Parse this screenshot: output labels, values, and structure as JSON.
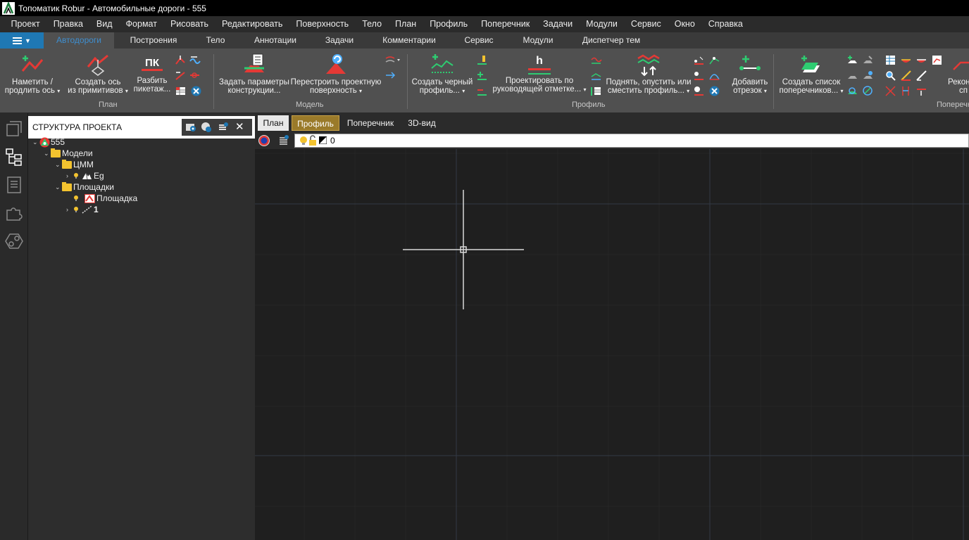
{
  "window": {
    "title": "Топоматик Robur - Автомобильные дороги - 555"
  },
  "menu": [
    "Проект",
    "Правка",
    "Вид",
    "Формат",
    "Рисовать",
    "Редактировать",
    "Поверхность",
    "Тело",
    "План",
    "Профиль",
    "Поперечник",
    "Задачи",
    "Модули",
    "Сервис",
    "Окно",
    "Справка"
  ],
  "ribbon_tabs": [
    "Автодороги",
    "Построения",
    "Тело",
    "Аннотации",
    "Задачи",
    "Комментарии",
    "Сервис",
    "Модули",
    "Диспетчер тем"
  ],
  "ribbon": {
    "btn_namet_1": "Наметить /",
    "btn_namet_2": "продлить ось",
    "btn_sozd_os_1": "Создать ось",
    "btn_sozd_os_2": "из примитивов",
    "btn_razbit_1": "Разбить",
    "btn_razbit_2": "пикетаж...",
    "pk_label": "ПК",
    "btn_zadat_1": "Задать параметры",
    "btn_zadat_2": "конструкции...",
    "btn_perestr_1": "Перестроить проектную",
    "btn_perestr_2": "поверхность",
    "btn_chern_1": "Создать черный",
    "btn_chern_2": "профиль...",
    "btn_proekt_1": "Проектировать по",
    "btn_proekt_2": "руководящей отметке...",
    "h_label": "h",
    "btn_podnyat_1": "Поднять, опустить или",
    "btn_podnyat_2": "сместить профиль...",
    "btn_dobavit_1": "Добавить",
    "btn_dobavit_2": "отрезок",
    "btn_sozd_spisok_1": "Создать список",
    "btn_sozd_spisok_2": "поперечников...",
    "btn_rekon_1": "Рекон",
    "btn_rekon_2": "сп",
    "group_plan": "План",
    "group_model": "Модель",
    "group_profile": "Профиль",
    "group_poper": "Поперечн"
  },
  "panel": {
    "title": "СТРУКТУРА ПРОЕКТА",
    "close": "✕",
    "tree": {
      "root": "555",
      "models": "Модели",
      "cmm": "ЦММ",
      "eg": "Eg",
      "sites": "Площадки",
      "site": "Площадка",
      "one": "1"
    }
  },
  "view_tabs": [
    "План",
    "Профиль",
    "Поперечник",
    "3D-вид"
  ],
  "layer": {
    "name": "0"
  },
  "colors": {
    "accent": "#1f78b4",
    "ribbon_bg": "#505050",
    "canvas_bg": "#1f1f1f",
    "active_view_tab": "#9a7a2a"
  }
}
